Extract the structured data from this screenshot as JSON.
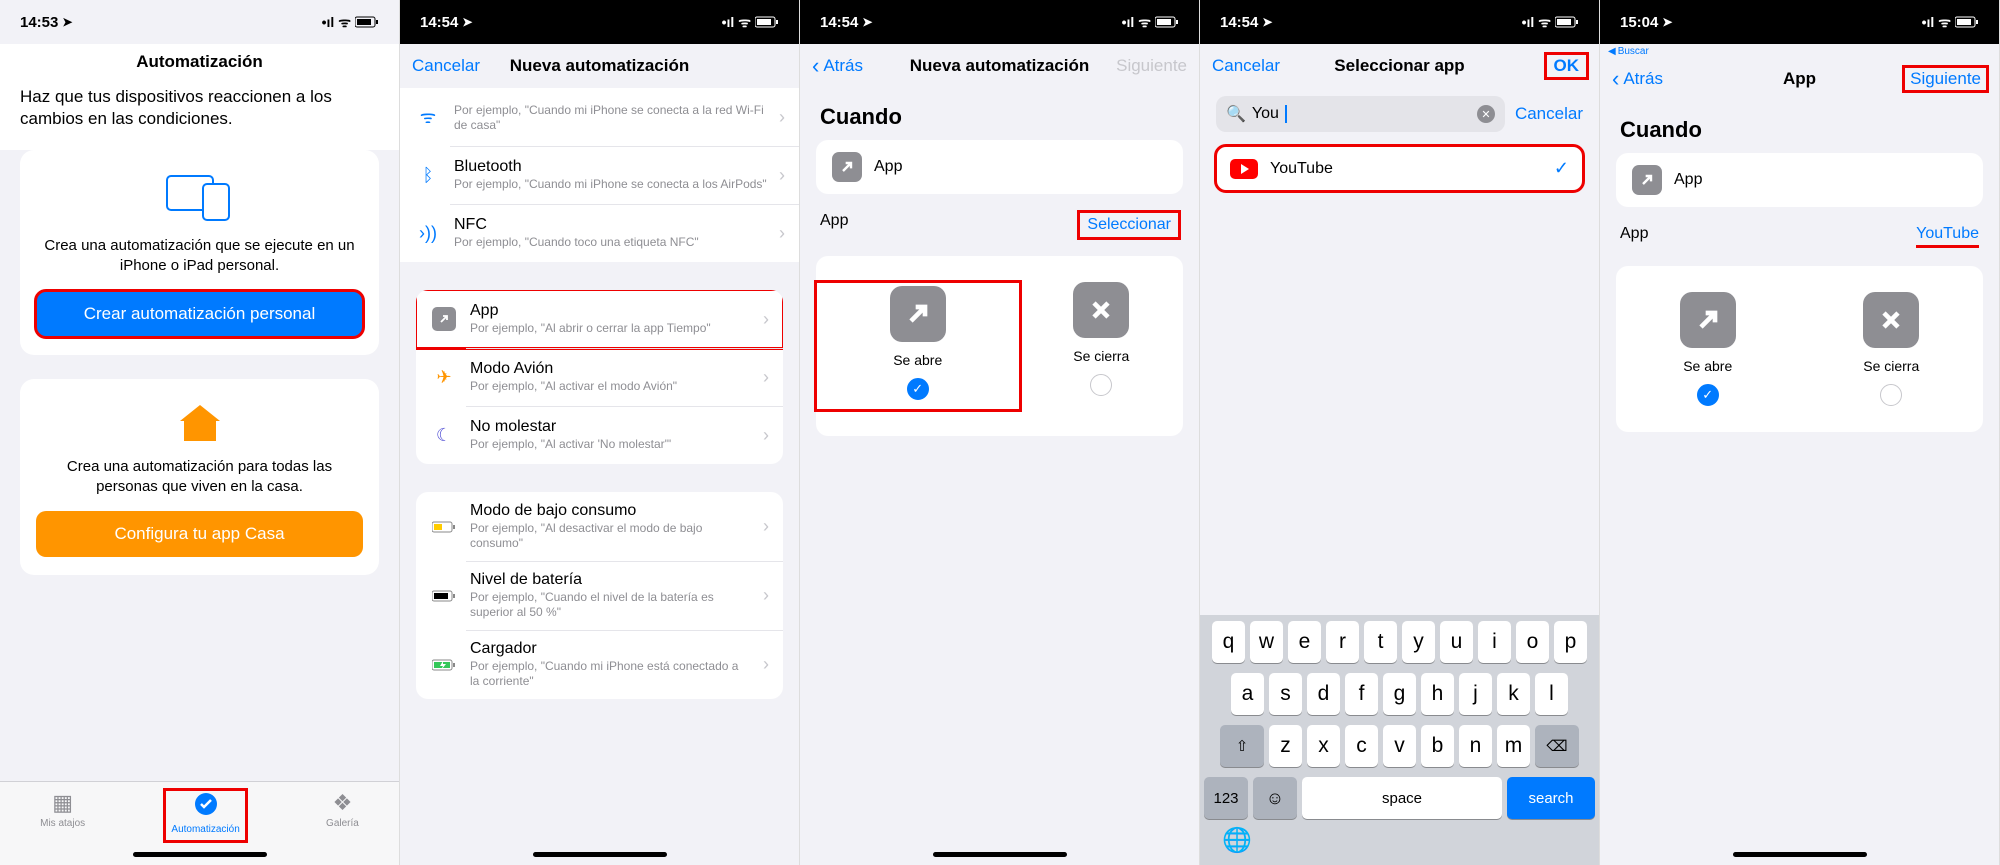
{
  "s1": {
    "time": "14:53",
    "title": "Automatización",
    "subtitle": "Haz que tus dispositivos reaccionen a los cambios en las condiciones.",
    "card1_text": "Crea una automatización que se ejecute en un iPhone o iPad personal.",
    "card1_btn": "Crear automatización personal",
    "card2_text": "Crea una automatización para todas las personas que viven en la casa.",
    "card2_btn": "Configura tu app Casa",
    "tabs": {
      "shortcuts": "Mis atajos",
      "automation": "Automatización",
      "gallery": "Galería"
    }
  },
  "s2": {
    "time": "14:54",
    "cancel": "Cancelar",
    "title": "Nueva automatización",
    "rows": {
      "wifi_sub": "Por ejemplo, \"Cuando mi iPhone se conecta a la red Wi-Fi de casa\"",
      "bt": "Bluetooth",
      "bt_sub": "Por ejemplo, \"Cuando mi iPhone se conecta a los AirPods\"",
      "nfc": "NFC",
      "nfc_sub": "Por ejemplo, \"Cuando toco una etiqueta NFC\"",
      "app": "App",
      "app_sub": "Por ejemplo, \"Al abrir o cerrar la app Tiempo\"",
      "air": "Modo Avión",
      "air_sub": "Por ejemplo, \"Al activar el modo Avión\"",
      "dnd": "No molestar",
      "dnd_sub": "Por ejemplo, \"Al activar 'No molestar'\"",
      "low": "Modo de bajo consumo",
      "low_sub": "Por ejemplo, \"Al desactivar el modo de bajo consumo\"",
      "bat": "Nivel de batería",
      "bat_sub": "Por ejemplo, \"Cuando el nivel de la batería es superior al 50 %\"",
      "chg": "Cargador",
      "chg_sub": "Por ejemplo, \"Cuando mi iPhone está conectado a la corriente\""
    }
  },
  "s3": {
    "time": "14:54",
    "back": "Atrás",
    "title": "Nueva automatización",
    "next": "Siguiente",
    "when": "Cuando",
    "app": "App",
    "app_label": "App",
    "select": "Seleccionar",
    "open": "Se abre",
    "close": "Se cierra"
  },
  "s4": {
    "time": "14:54",
    "cancel": "Cancelar",
    "title": "Seleccionar app",
    "ok": "OK",
    "search_value": "You",
    "result": "YouTube",
    "kb": {
      "r1": [
        "q",
        "w",
        "e",
        "r",
        "t",
        "y",
        "u",
        "i",
        "o",
        "p"
      ],
      "r2": [
        "a",
        "s",
        "d",
        "f",
        "g",
        "h",
        "j",
        "k",
        "l"
      ],
      "r3": [
        "z",
        "x",
        "c",
        "v",
        "b",
        "n",
        "m"
      ],
      "num": "123",
      "space": "space",
      "search": "search"
    }
  },
  "s5": {
    "time": "15:04",
    "back_small": "Buscar",
    "back": "Atrás",
    "title": "App",
    "next": "Siguiente",
    "when": "Cuando",
    "app": "App",
    "app_label": "App",
    "selected": "YouTube",
    "open": "Se abre",
    "close": "Se cierra"
  }
}
